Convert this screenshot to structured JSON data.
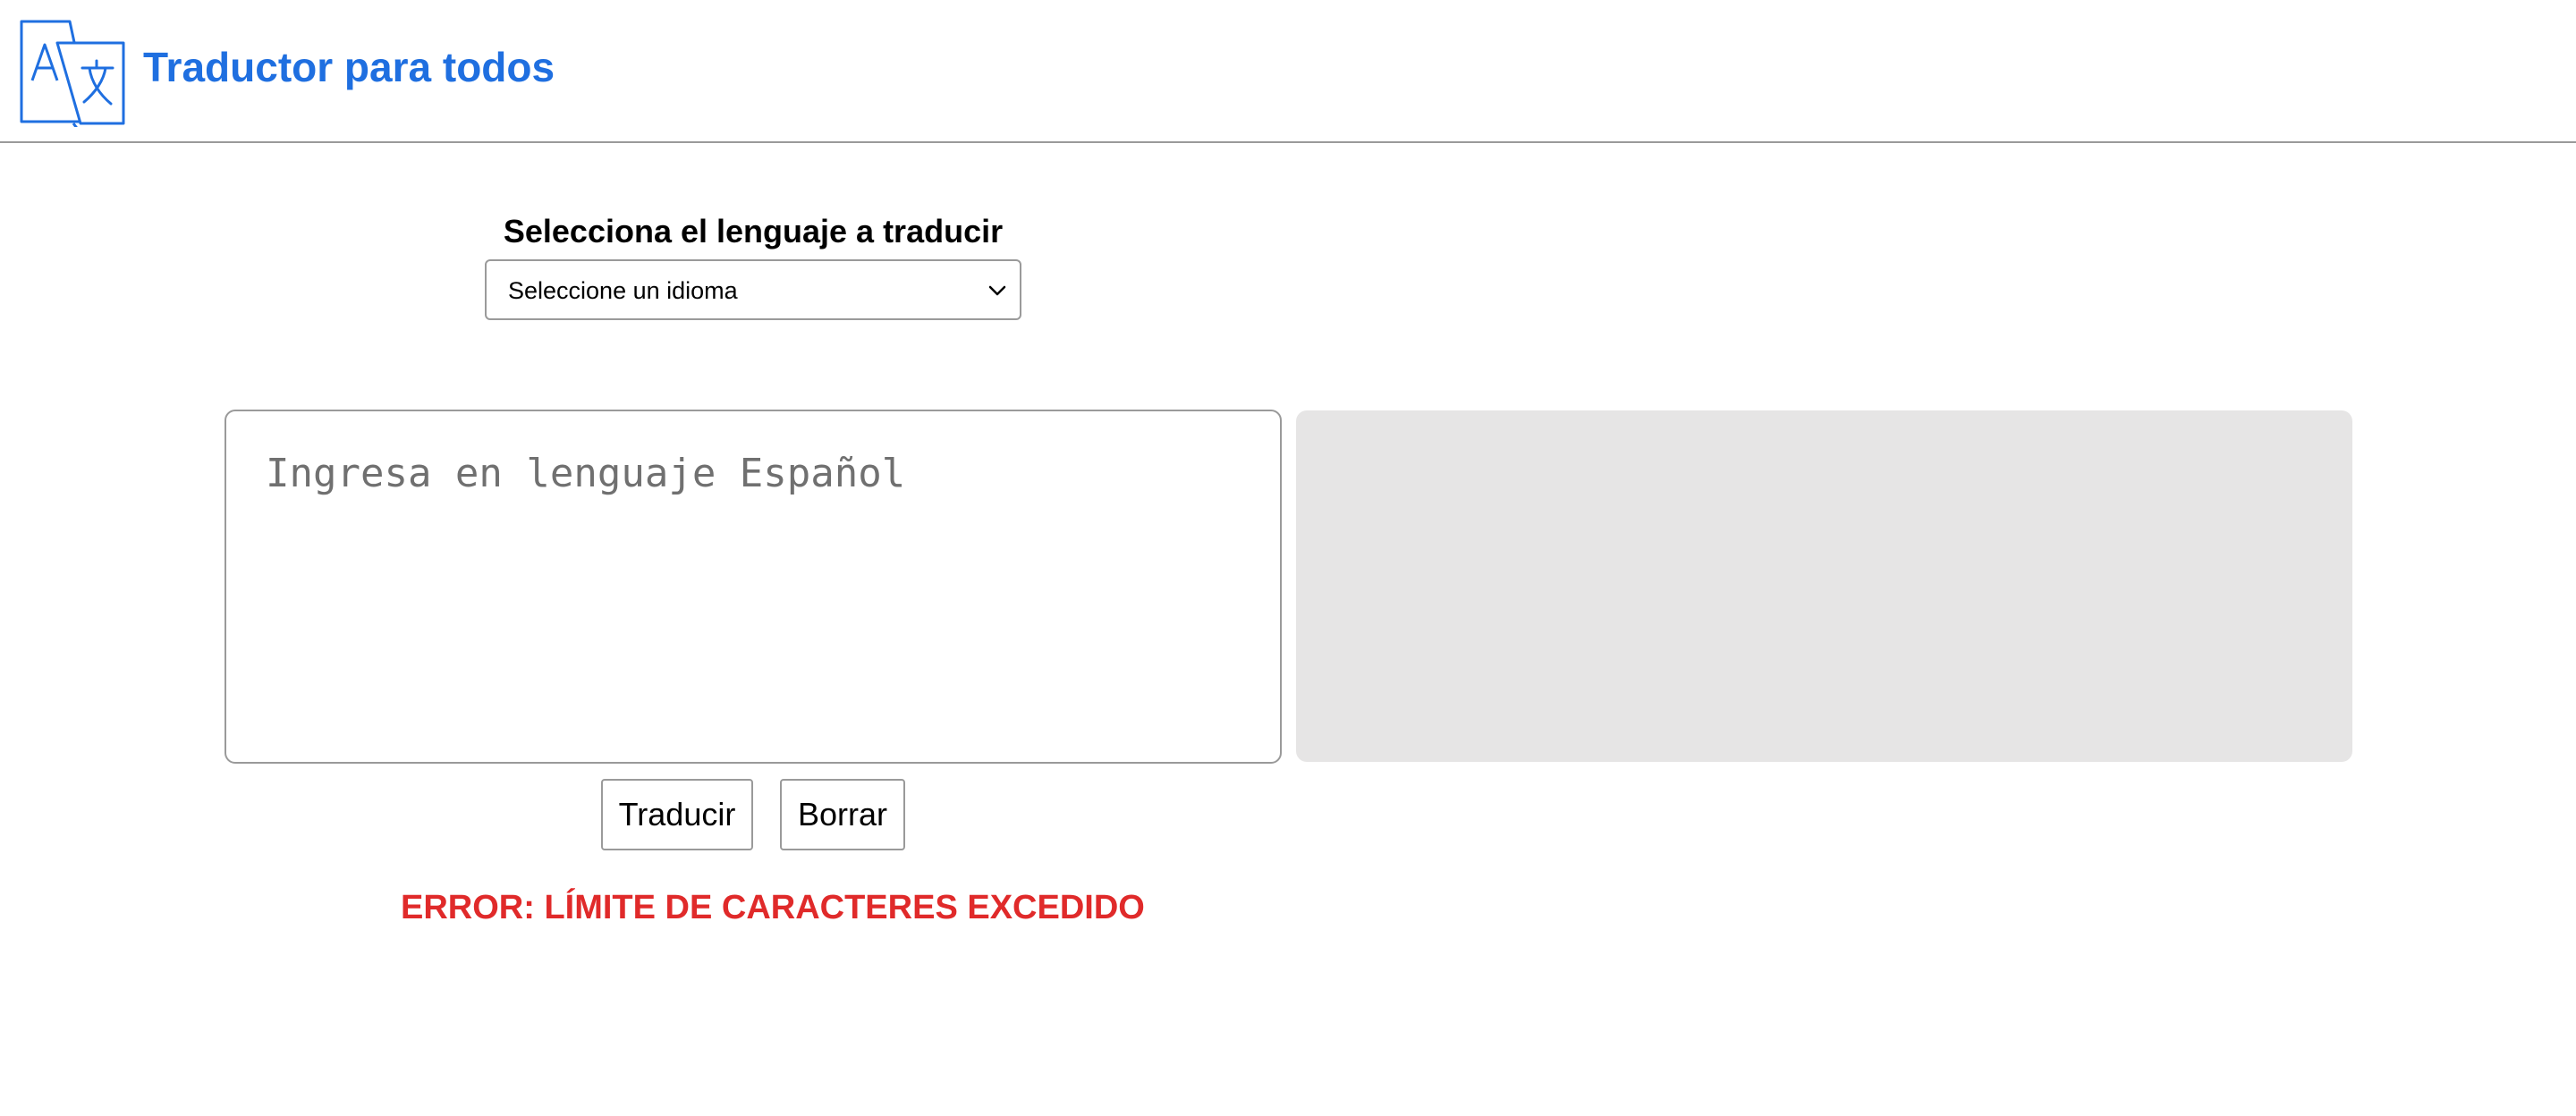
{
  "header": {
    "title": "Traductor para todos",
    "logo_icon": "translate-icon",
    "accent_color": "#1f6fe0"
  },
  "language": {
    "label": "Selecciona el lenguaje a traducir",
    "selected": "Seleccione un idioma"
  },
  "source": {
    "placeholder": "Ingresa en lenguaje Español",
    "value": ""
  },
  "target": {
    "value": ""
  },
  "buttons": {
    "translate": "Traducir",
    "clear": "Borrar"
  },
  "error": {
    "message": "ERROR: LÍMITE DE CARACTERES EXCEDIDO",
    "color": "#e02a2a"
  }
}
